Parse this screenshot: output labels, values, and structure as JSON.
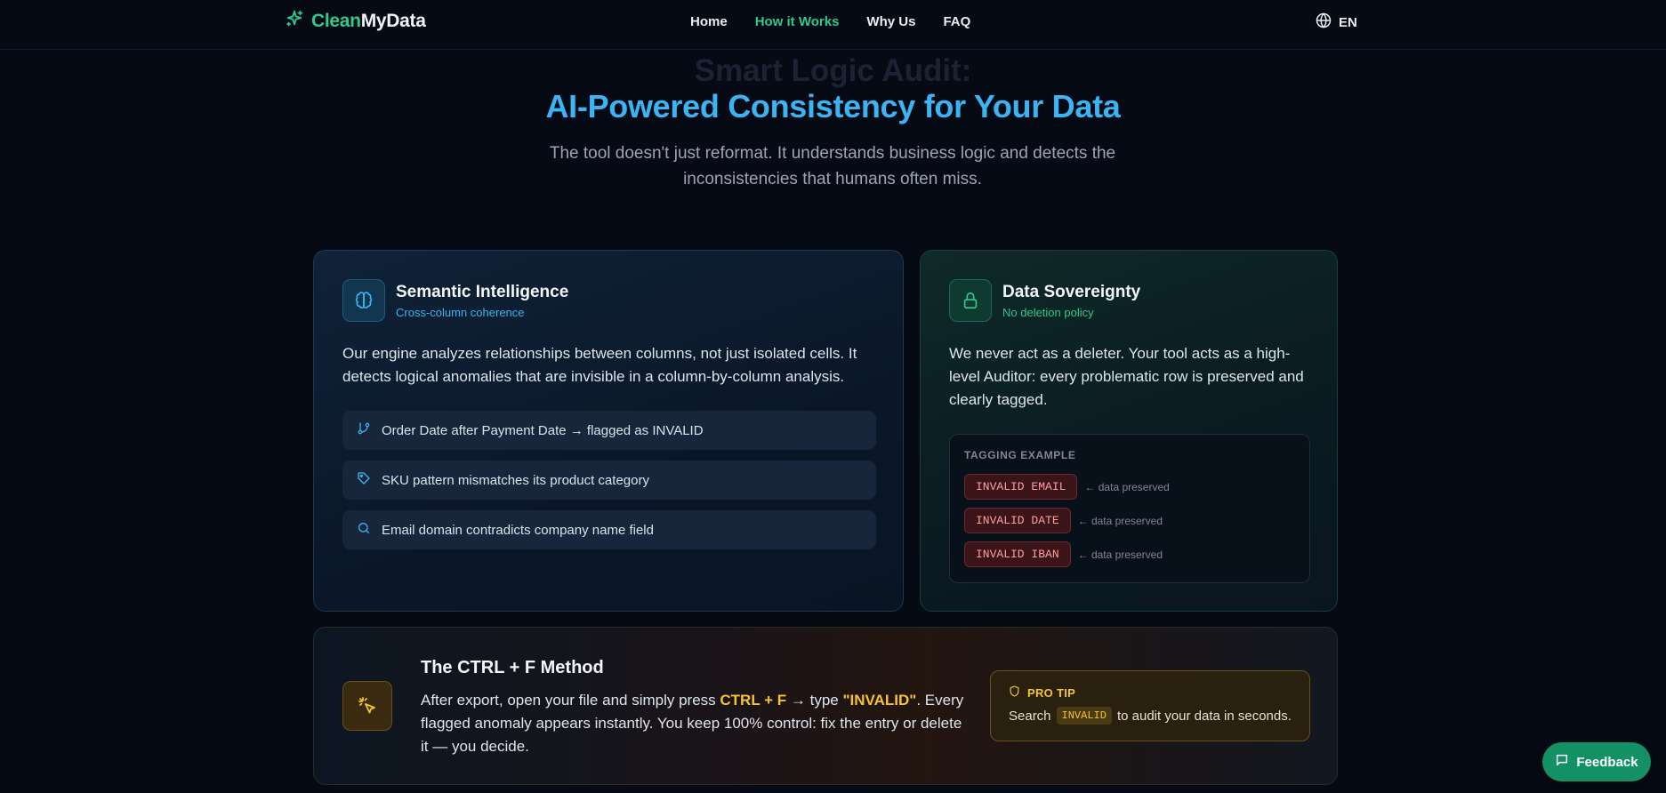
{
  "nav": {
    "logo_clean": "Clean",
    "logo_mydata": "MyData",
    "links": [
      "Home",
      "How it Works",
      "Why Us",
      "FAQ"
    ],
    "active_link": "How it Works",
    "language": "EN"
  },
  "hero": {
    "faded_heading": "Smart Logic Audit:",
    "title": "AI-Powered Consistency for Your Data",
    "subtitle": "The tool doesn't just reformat. It understands business logic and detects the inconsistencies that humans often miss."
  },
  "semantic": {
    "title": "Semantic Intelligence",
    "kicker": "Cross-column coherence",
    "body": "Our engine analyzes relationships between columns, not just isolated cells. It detects logical anomalies that are invisible in a column-by-column analysis.",
    "examples": [
      {
        "icon": "git-branch-icon",
        "text": "Order Date after Payment Date → flagged as INVALID"
      },
      {
        "icon": "tag-icon",
        "text": "SKU pattern mismatches its product category"
      },
      {
        "icon": "search-icon",
        "text": "Email domain contradicts company name field"
      }
    ]
  },
  "sovereignty": {
    "title": "Data Sovereignty",
    "kicker": "No deletion policy",
    "body": "We never act as a deleter. Your tool acts as a high-level Auditor: every problematic row is preserved and clearly tagged.",
    "tagging_title": "TAGGING EXAMPLE",
    "tags": [
      {
        "label": "INVALID EMAIL",
        "note": "← data preserved"
      },
      {
        "label": "INVALID DATE",
        "note": "← data preserved"
      },
      {
        "label": "INVALID IBAN",
        "note": "← data preserved"
      }
    ]
  },
  "ctrlf": {
    "title": "The CTRL + F Method",
    "body_1": "After export, open your file and simply press ",
    "body_key": "CTRL + F",
    "body_2": " → type ",
    "body_type": "\"INVALID\"",
    "body_3": ". Every flagged anomaly appears instantly. You keep 100% control: fix the entry or delete it — you decide.",
    "protip_title": "PRO TIP",
    "protip_pre": "Search",
    "protip_code": "INVALID",
    "protip_post": "to audit your data in seconds."
  },
  "feedback": {
    "label": "Feedback"
  },
  "colors": {
    "background": "#050a14",
    "accent_green": "#2fc98a",
    "accent_blue": "#3ab4f2",
    "accent_amber": "#f5c42d",
    "tag_red": "#ffa0a0"
  }
}
